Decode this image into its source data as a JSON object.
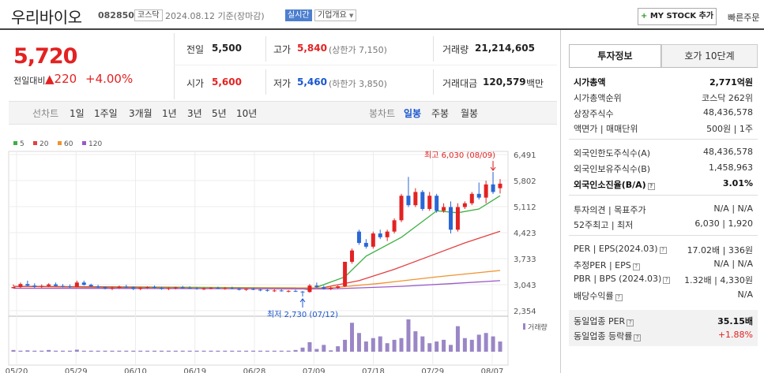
{
  "header": {
    "name": "우리바이오",
    "code": "082850",
    "market": "코스닥",
    "date": "2024.08.12 기준(장마감)",
    "realtime": "실시간",
    "company_overview": "기업개요",
    "mystock_plus": "+",
    "mystock_label": "MY STOCK 추가",
    "quick_order": "빠른주문"
  },
  "price": {
    "current": "5,720",
    "change_label": "전일대비",
    "change_arrow": "▲",
    "change_amount": "220",
    "change_pct": "+4.00%"
  },
  "quote": {
    "prev_label": "전일",
    "prev": "5,500",
    "high_label": "고가",
    "high": "5,840",
    "upper_limit": "(상한가 7,150)",
    "volume_label": "거래량",
    "volume": "21,214,605",
    "open_label": "시가",
    "open": "5,600",
    "low_label": "저가",
    "low": "5,460",
    "lower_limit": "(하한가 3,850)",
    "amount_label": "거래대금",
    "amount": "120,579",
    "amount_unit": "백만"
  },
  "periods": {
    "line_label": "선차트",
    "items": [
      "1일",
      "1주일",
      "3개월",
      "1년",
      "3년",
      "5년",
      "10년"
    ],
    "candle_label": "봉차트",
    "candle_items": [
      "일봉",
      "주봉",
      "월봉"
    ],
    "selected_candle": "일봉"
  },
  "legend": [
    {
      "label": "5",
      "color": "#3cb043"
    },
    {
      "label": "20",
      "color": "#e34040"
    },
    {
      "label": "60",
      "color": "#f0922d"
    },
    {
      "label": "120",
      "color": "#9b59c7"
    }
  ],
  "chart_data": {
    "type": "candlestick",
    "y_ticks": [
      "6,491",
      "5,802",
      "5,112",
      "4,423",
      "3,733",
      "3,043",
      "2,354"
    ],
    "ylim": [
      2354,
      6491
    ],
    "x_labels": [
      "05/20",
      "05/29",
      "06/10",
      "06/19",
      "06/28",
      "07/09",
      "07/18",
      "07/29",
      "08/07"
    ],
    "annotation_high": "최고 6,030 (08/09)",
    "annotation_low": "최저 2,730 (07/12)",
    "volume_label": "거래량",
    "candles": [
      [
        2950,
        3050,
        3000,
        2980
      ],
      [
        2980,
        3100,
        2950,
        3060
      ],
      [
        3060,
        3150,
        3000,
        3020
      ],
      [
        3020,
        3080,
        2950,
        2990
      ],
      [
        2990,
        3050,
        2960,
        3010
      ],
      [
        3010,
        3080,
        2980,
        3050
      ],
      [
        3050,
        3100,
        3000,
        3010
      ],
      [
        3010,
        3060,
        2970,
        3000
      ],
      [
        3000,
        3050,
        2960,
        2980
      ],
      [
        2980,
        3150,
        2970,
        3100
      ],
      [
        3100,
        3150,
        3020,
        3040
      ],
      [
        3040,
        3070,
        2980,
        3000
      ],
      [
        3000,
        3040,
        2950,
        2970
      ],
      [
        2970,
        3000,
        2920,
        2940
      ],
      [
        2940,
        3000,
        2900,
        2960
      ],
      [
        2960,
        3020,
        2930,
        2990
      ],
      [
        2990,
        3040,
        2950,
        2970
      ],
      [
        2970,
        3000,
        2900,
        2930
      ],
      [
        2930,
        2990,
        2900,
        2960
      ],
      [
        2960,
        3000,
        2930,
        2980
      ],
      [
        2980,
        3020,
        2940,
        2960
      ],
      [
        2960,
        2990,
        2910,
        2930
      ],
      [
        2930,
        2970,
        2900,
        2950
      ],
      [
        2950,
        2990,
        2920,
        2970
      ],
      [
        2970,
        3010,
        2940,
        2960
      ],
      [
        2960,
        3000,
        2930,
        2950
      ],
      [
        2950,
        2980,
        2910,
        2930
      ],
      [
        2930,
        2970,
        2900,
        2940
      ],
      [
        2940,
        2980,
        2920,
        2960
      ],
      [
        2960,
        2990,
        2930,
        2940
      ],
      [
        2940,
        2980,
        2910,
        2950
      ],
      [
        2950,
        2990,
        2920,
        2930
      ],
      [
        2930,
        2960,
        2890,
        2910
      ],
      [
        2910,
        2950,
        2880,
        2930
      ],
      [
        2930,
        2960,
        2900,
        2910
      ],
      [
        2910,
        2940,
        2870,
        2900
      ],
      [
        2900,
        2930,
        2860,
        2880
      ],
      [
        2880,
        2920,
        2850,
        2890
      ],
      [
        2890,
        2920,
        2860,
        2870
      ],
      [
        2870,
        2900,
        2840,
        2880
      ],
      [
        2880,
        2910,
        2850,
        2860
      ],
      [
        2860,
        2880,
        2730,
        2850
      ],
      [
        2850,
        3060,
        2830,
        3020
      ],
      [
        3020,
        3100,
        2960,
        2980
      ],
      [
        2980,
        3020,
        2910,
        2940
      ],
      [
        2940,
        2990,
        2900,
        2960
      ],
      [
        2960,
        3020,
        2930,
        3000
      ],
      [
        3000,
        3600,
        2980,
        3650
      ],
      [
        3650,
        4000,
        3600,
        3950
      ],
      [
        4450,
        4500,
        4100,
        4150
      ],
      [
        4150,
        4250,
        4000,
        4050
      ],
      [
        4050,
        4450,
        4000,
        4400
      ],
      [
        4400,
        4500,
        4250,
        4300
      ],
      [
        4300,
        4500,
        4200,
        4450
      ],
      [
        4450,
        4800,
        4400,
        4750
      ],
      [
        4750,
        5450,
        4700,
        5400
      ],
      [
        5400,
        5900,
        5100,
        5150
      ],
      [
        5150,
        5600,
        5100,
        5500
      ],
      [
        5500,
        5550,
        5000,
        5050
      ],
      [
        5050,
        5500,
        5000,
        5400
      ],
      [
        5400,
        5450,
        4950,
        5000
      ],
      [
        5000,
        5200,
        4950,
        5100
      ],
      [
        5100,
        5250,
        4400,
        4500
      ],
      [
        4500,
        5200,
        4450,
        5100
      ],
      [
        5100,
        5250,
        5050,
        5200
      ],
      [
        5200,
        5500,
        5150,
        5450
      ],
      [
        5450,
        5750,
        5300,
        5350
      ],
      [
        5350,
        5800,
        5200,
        5700
      ],
      [
        5700,
        6030,
        5450,
        5500
      ],
      [
        5600,
        5840,
        5460,
        5720
      ]
    ],
    "volume_rel": [
      0.05,
      0.03,
      0.04,
      0.03,
      0.03,
      0.05,
      0.03,
      0.03,
      0.03,
      0.06,
      0.03,
      0.03,
      0.03,
      0.03,
      0.03,
      0.03,
      0.03,
      0.03,
      0.03,
      0.03,
      0.03,
      0.03,
      0.03,
      0.03,
      0.03,
      0.03,
      0.03,
      0.03,
      0.03,
      0.03,
      0.03,
      0.03,
      0.03,
      0.03,
      0.03,
      0.03,
      0.03,
      0.03,
      0.03,
      0.03,
      0.05,
      0.12,
      0.28,
      0.08,
      0.2,
      0.04,
      0.16,
      0.35,
      0.85,
      0.55,
      0.3,
      0.4,
      0.45,
      0.25,
      0.35,
      0.4,
      0.95,
      0.6,
      0.45,
      0.25,
      0.3,
      0.35,
      0.2,
      0.75,
      0.4,
      0.35,
      0.5,
      0.55,
      0.45,
      0.3
    ],
    "ma": {
      "5": [
        [
          0,
          3000
        ],
        [
          40,
          2960
        ],
        [
          42,
          2910
        ],
        [
          47,
          3250
        ],
        [
          50,
          3800
        ],
        [
          55,
          4300
        ],
        [
          60,
          5000
        ],
        [
          63,
          4950
        ],
        [
          66,
          5050
        ],
        [
          69,
          5400
        ]
      ],
      "20": [
        [
          0,
          3000
        ],
        [
          43,
          2930
        ],
        [
          49,
          3150
        ],
        [
          54,
          3450
        ],
        [
          59,
          3800
        ],
        [
          64,
          4150
        ],
        [
          69,
          4460
        ]
      ],
      "60": [
        [
          0,
          2950
        ],
        [
          45,
          2960
        ],
        [
          52,
          3080
        ],
        [
          60,
          3250
        ],
        [
          69,
          3420
        ]
      ],
      "120": [
        [
          0,
          2950
        ],
        [
          45,
          2930
        ],
        [
          55,
          3000
        ],
        [
          62,
          3070
        ],
        [
          69,
          3150
        ]
      ]
    }
  },
  "right_panel": {
    "tab_info": "투자정보",
    "tab_hoga": "호가 10단계",
    "rows": {
      "market_cap_label": "시가총액",
      "market_cap": "2,771억원",
      "market_cap_rank_label": "시가총액순위",
      "market_cap_rank": "코스닥 262위",
      "listed_shares_label": "상장주식수",
      "listed_shares": "48,436,578",
      "par_label": "액면가 | 매매단위",
      "par": "500원 | 1주",
      "foreign_limit_label": "외국인한도주식수(A)",
      "foreign_limit": "48,436,578",
      "foreign_hold_label": "외국인보유주식수(B)",
      "foreign_hold": "1,458,963",
      "foreign_ratio_label": "외국인소진율(B/A)",
      "foreign_ratio": "3.01%",
      "opinion_label": "투자의견 | 목표주가",
      "opinion": "N/A | N/A",
      "week52_label": "52주최고 | 최저",
      "week52": "6,030 | 1,920",
      "per_label": "PER | EPS(2024.03)",
      "per": "17.02배 | 336원",
      "est_per_label": "추정PER | EPS",
      "est_per": "N/A | N/A",
      "pbr_label": "PBR | BPS (2024.03)",
      "pbr": "1.32배 | 4,330원",
      "dividend_label": "배당수익률",
      "dividend": "N/A",
      "peer_per_label": "동일업종 PER",
      "peer_per": "35.15배",
      "peer_rate_label": "동일업종 등락률",
      "peer_rate": "+1.88%"
    }
  }
}
